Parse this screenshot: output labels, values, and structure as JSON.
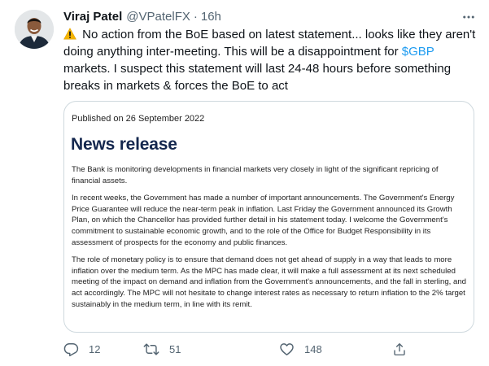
{
  "tweet": {
    "display_name": "Viraj Patel",
    "handle": "@VPatelFX",
    "separator": "·",
    "time": "16h",
    "text_before": "No action from the BoE based on latest statement... looks like they aren't doing anything inter-meeting. This will be a disappointment for ",
    "cashtag": "$GBP",
    "text_after": " markets. I suspect this statement will last 24-48 hours before something breaks in markets & forces the BoE to act"
  },
  "card": {
    "published": "Published on 26 September 2022",
    "title": "News release",
    "paragraphs": [
      "The Bank is monitoring developments in financial markets very closely in light of the significant repricing of financial assets.",
      "In recent weeks, the Government has made a number of important announcements. The Government's Energy Price Guarantee will reduce the near-term peak in inflation. Last Friday the Government announced its Growth Plan, on which the Chancellor has provided further detail in his statement today. I welcome the Government's commitment to sustainable economic growth, and to the role of the Office for Budget Responsibility in its assessment of prospects for the economy and public finances.",
      "The role of monetary policy is to ensure that demand does not get ahead of supply in a way that leads to more inflation over the medium term. As the MPC has made clear, it will make a full assessment at its next scheduled meeting of the impact on demand and inflation from the Government's announcements, and the fall in sterling, and act accordingly. The MPC will not hesitate to change interest rates as necessary to return inflation to the 2% target sustainably in the medium term, in line with its remit."
    ]
  },
  "actions": {
    "reply_count": "12",
    "retweet_count": "51",
    "like_count": "148"
  },
  "icons": {
    "warning": "warning-icon",
    "more": "more-icon",
    "reply": "reply-icon",
    "retweet": "retweet-icon",
    "like": "like-icon",
    "share": "share-icon"
  },
  "colors": {
    "text": "#0f1419",
    "muted": "#536471",
    "link": "#1d9bf0",
    "card_border": "#cfd9de",
    "news_title": "#14274e"
  }
}
